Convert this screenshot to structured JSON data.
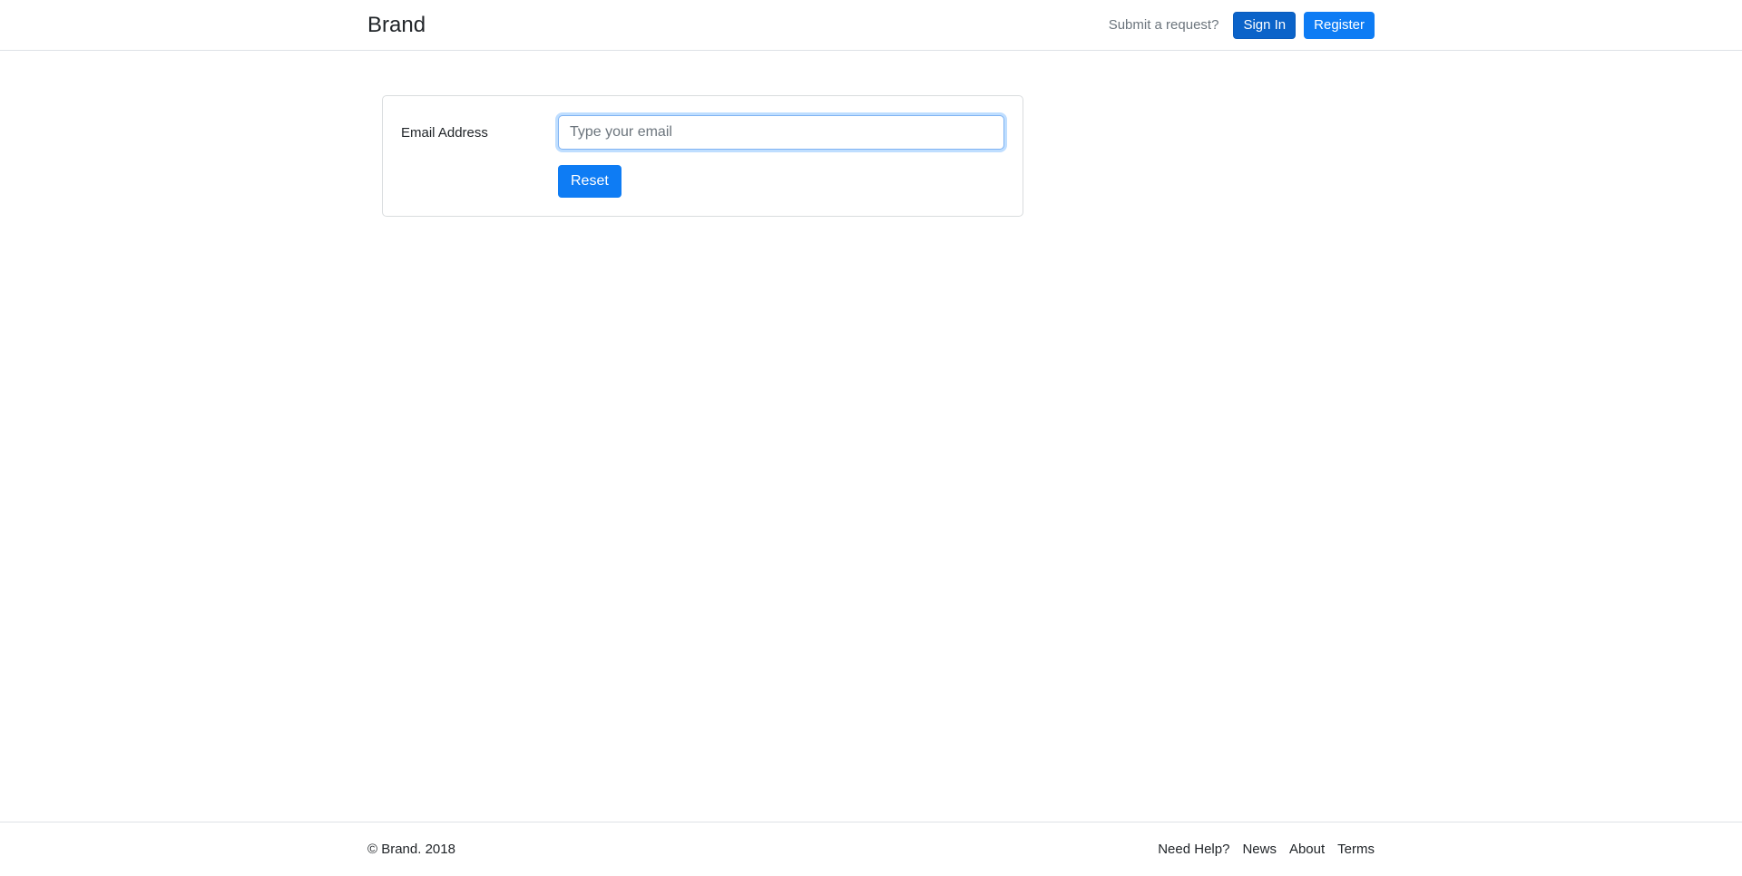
{
  "header": {
    "brand": "Brand",
    "submit_request": "Submit a request?",
    "sign_in": "Sign In",
    "register": "Register"
  },
  "reset_form": {
    "email_label": "Email Address",
    "email_placeholder": "Type your email",
    "email_value": "",
    "reset_button": "Reset"
  },
  "footer": {
    "copyright": "© Brand. 2018",
    "links": [
      "Need Help?",
      "News",
      "About",
      "Terms"
    ]
  },
  "colors": {
    "sign_in_button_bg": "#0b63c9",
    "register_button_bg": "#0e7cf4",
    "reset_button_bg": "#0e7cf4",
    "button_text": "#ffffff",
    "input_focus_border": "#7fb3f2",
    "input_focus_glow": "rgba(0,123,255,0.25)",
    "placeholder_text": "#6c757d",
    "muted_text": "#6c757d",
    "body_text": "#212529",
    "divider": "#dee2e6",
    "card_border": "#d9dcde"
  }
}
